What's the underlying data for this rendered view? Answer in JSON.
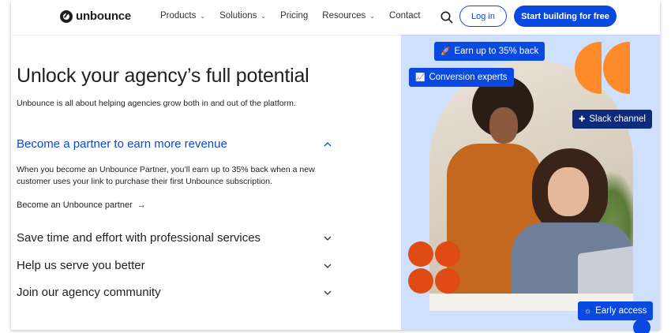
{
  "header": {
    "brand": "unbounce",
    "nav": [
      {
        "label": "Products",
        "has_menu": true
      },
      {
        "label": "Solutions",
        "has_menu": true
      },
      {
        "label": "Pricing",
        "has_menu": false
      },
      {
        "label": "Resources",
        "has_menu": true
      },
      {
        "label": "Contact",
        "has_menu": false
      }
    ],
    "login_label": "Log in",
    "cta_label": "Start building for free"
  },
  "hero": {
    "title": "Unlock your agency’s full potential",
    "subtitle": "Unbounce is all about helping agencies grow both in and out of the platform."
  },
  "accordion": [
    {
      "title": "Become a partner to earn more revenue",
      "open": true,
      "body": "When you become an Unbounce Partner, you’ll earn up to 35% back when a new customer uses your link to purchase their first Unbounce subscription.",
      "link": "Become an Unbounce partner"
    },
    {
      "title": "Save time and effort with professional services",
      "open": false
    },
    {
      "title": "Help us serve you better",
      "open": false
    },
    {
      "title": "Join our agency community",
      "open": false
    }
  ],
  "visual": {
    "chips": {
      "earn": "Earn up to 35% back",
      "conversion": "Conversion experts",
      "slack": "Slack channel",
      "early": "Early access"
    },
    "colors": {
      "background": "#cfe0ff",
      "orange": "#ff8a2a",
      "red_orange": "#e04a14",
      "brand_blue": "#0a49e0"
    }
  }
}
